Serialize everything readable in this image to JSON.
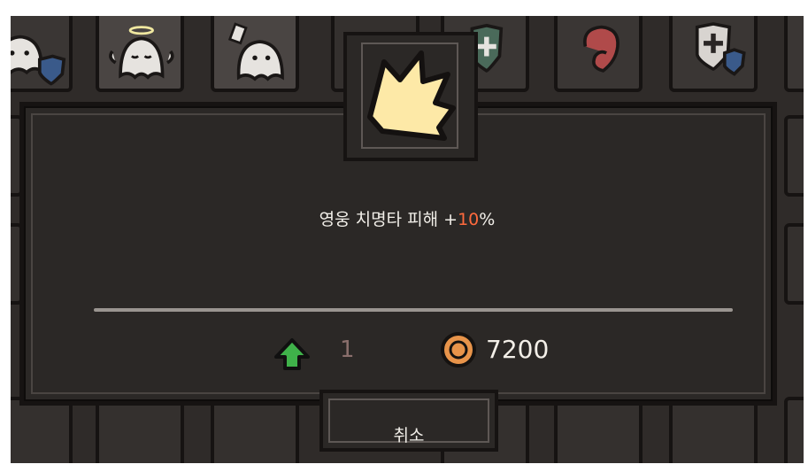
{
  "dialog": {
    "description": {
      "prefix": "영웅 치명타 피해 +",
      "value": "10",
      "suffix": "%"
    },
    "upgrade_icon": "green-up-arrow-icon",
    "upgrade_count": "1",
    "coin_icon": "coin-icon",
    "coin_cost": "7200",
    "cancel_label": "취소",
    "highlight_color": "#ff6a3d"
  },
  "background_slots": [
    {
      "icon": "ghost-with-shield-icon"
    },
    {
      "icon": "angel-ghost-icon"
    },
    {
      "icon": "ghost-with-card-icon"
    },
    {
      "icon": "shield-plus-icon"
    },
    {
      "icon": "red-swirl-icon"
    },
    {
      "icon": "shield-plus-small-shield-icon"
    }
  ]
}
